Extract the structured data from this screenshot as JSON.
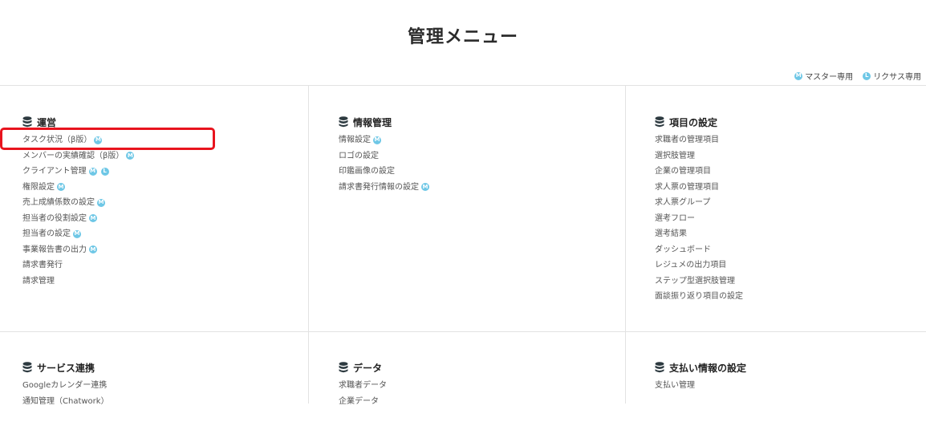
{
  "page": {
    "title": "管理メニュー"
  },
  "legend": {
    "master_label": "マスター専用",
    "recuses_label": "リクサス専用",
    "badge_m": "M",
    "badge_l": "L"
  },
  "sections": [
    {
      "title": "運営",
      "items": [
        {
          "label": "タスク状況（β版）",
          "badges": [
            "M"
          ]
        },
        {
          "label": "メンバーの実績確認（β版）",
          "badges": [
            "M"
          ]
        },
        {
          "label": "クライアント管理",
          "badges": [
            "M",
            "L"
          ]
        },
        {
          "label": "権限設定",
          "badges": [
            "M"
          ]
        },
        {
          "label": "売上成績係数の設定",
          "badges": [
            "M"
          ]
        },
        {
          "label": "担当者の役割設定",
          "badges": [
            "M"
          ]
        },
        {
          "label": "担当者の設定",
          "badges": [
            "M"
          ]
        },
        {
          "label": "事業報告書の出力",
          "badges": [
            "M"
          ]
        },
        {
          "label": "請求書発行",
          "badges": []
        },
        {
          "label": "請求管理",
          "badges": []
        }
      ]
    },
    {
      "title": "情報管理",
      "items": [
        {
          "label": "情報設定",
          "badges": [
            "M"
          ]
        },
        {
          "label": "ロゴの設定",
          "badges": []
        },
        {
          "label": "印鑑画像の設定",
          "badges": []
        },
        {
          "label": "請求書発行情報の設定",
          "badges": [
            "M"
          ]
        }
      ]
    },
    {
      "title": "項目の設定",
      "items": [
        {
          "label": "求職者の管理項目",
          "badges": []
        },
        {
          "label": "選択肢管理",
          "badges": []
        },
        {
          "label": "企業の管理項目",
          "badges": []
        },
        {
          "label": "求人票の管理項目",
          "badges": []
        },
        {
          "label": "求人票グループ",
          "badges": []
        },
        {
          "label": "選考フロー",
          "badges": []
        },
        {
          "label": "選考結果",
          "badges": []
        },
        {
          "label": "ダッシュボード",
          "badges": []
        },
        {
          "label": "レジュメの出力項目",
          "badges": []
        },
        {
          "label": "ステップ型選択肢管理",
          "badges": []
        },
        {
          "label": "面談振り返り項目の設定",
          "badges": []
        }
      ]
    },
    {
      "title": "サービス連携",
      "items": [
        {
          "label": "Googleカレンダー連携",
          "badges": []
        },
        {
          "label": "通知管理（Chatwork）",
          "badges": []
        }
      ]
    },
    {
      "title": "データ",
      "items": [
        {
          "label": "求職者データ",
          "badges": []
        },
        {
          "label": "企業データ",
          "badges": []
        }
      ]
    },
    {
      "title": "支払い情報の設定",
      "items": [
        {
          "label": "支払い管理",
          "badges": []
        }
      ]
    }
  ],
  "colors": {
    "badge": "#6ec7e6",
    "highlight": "#e8141e",
    "divider": "#e2e2e2"
  }
}
